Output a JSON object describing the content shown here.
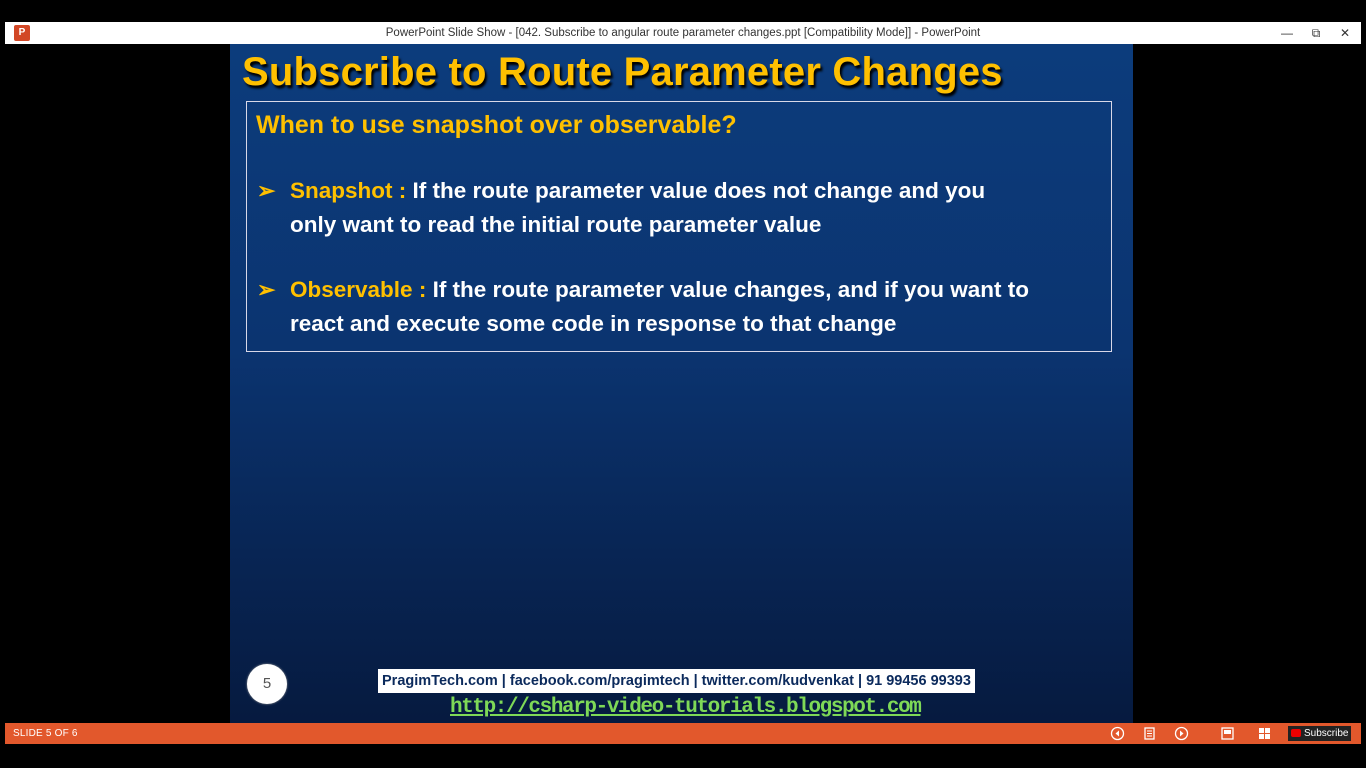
{
  "window": {
    "title": "PowerPoint Slide Show - [042. Subscribe to angular route parameter changes.ppt [Compatibility Mode]] - PowerPoint",
    "app_icon_letter": "P",
    "minimize_label": "—",
    "restore_label": "⧉",
    "close_label": "✕"
  },
  "slide": {
    "title": "Subscribe to Route Parameter Changes",
    "question": "When to use snapshot over observable?",
    "bullets": [
      {
        "term": "Snapshot  :",
        "line1_text": " If the route parameter value does not change and you",
        "line2_text": "only want to read the initial route parameter value"
      },
      {
        "term": "Observable :",
        "line1_text": " If the route parameter value changes, and if you want to",
        "line2_text": "react and execute some code in response to that change"
      }
    ],
    "bullet_glyph": "➢",
    "number": "5",
    "footer_contact": "PragimTech.com | facebook.com/pragimtech  | twitter.com/kudvenkat  | 91 99456 99393",
    "footer_link": "http://csharp-video-tutorials.blogspot.com"
  },
  "statusbar": {
    "slide_indicator": "SLIDE 5 OF 6",
    "icons": [
      "previous-icon",
      "reading-view-icon",
      "next-icon",
      "notes-icon",
      "slide-sorter-icon",
      "menu-icon"
    ],
    "subscribe_label": "Subscribe"
  },
  "colors": {
    "slide_bg": "#0b3470",
    "title_accent": "#ffc000",
    "statusbar": "#e2582c",
    "link": "#7ed957"
  }
}
